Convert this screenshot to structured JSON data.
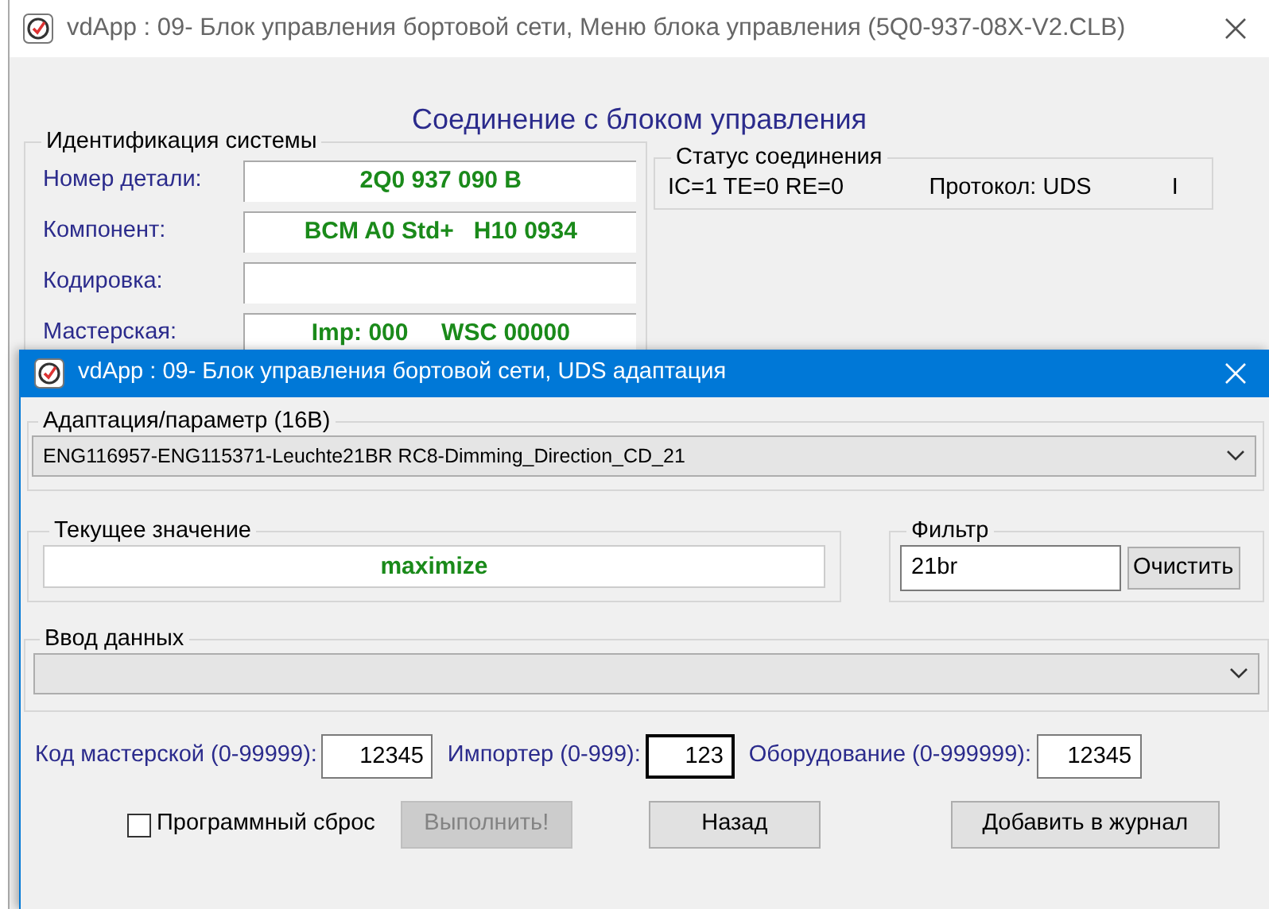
{
  "back_window": {
    "title": "vdApp : 09- Блок управления бортовой сети,  Меню блока управления (5Q0-937-08X-V2.CLB)",
    "heading": "Соединение с блоком управления",
    "identification": {
      "legend": "Идентификация системы",
      "rows": [
        {
          "label": "Номер детали:",
          "value": "2Q0 937 090 B"
        },
        {
          "label": "Компонент:",
          "value": "BCM A0 Std+   H10 0934"
        },
        {
          "label": "Кодировка:"
        },
        {
          "label": "Мастерская:",
          "value": "Imp: 000     WSC 00000"
        }
      ]
    },
    "status": {
      "legend": "Статус соединения",
      "items": [
        "IC=1 TE=0 RE=0",
        "Протокол: UDS",
        "I"
      ]
    }
  },
  "dialog": {
    "title": "vdApp : 09- Блок управления бортовой сети,  UDS адаптация",
    "adaptation": {
      "legend": "Адаптация/параметр (16B)",
      "value": "ENG116957-ENG115371-Leuchte21BR RC8-Dimming_Direction_CD_21"
    },
    "current": {
      "legend": "Текущее значение",
      "value": "maximize"
    },
    "filter": {
      "legend": "Фильтр",
      "value": "21br",
      "button": "Очистить"
    },
    "data_input": {
      "legend": "Ввод данных"
    },
    "codes": [
      {
        "label": "Код мастерской (0-99999):",
        "value": "12345"
      },
      {
        "label": "Импортер (0-999):",
        "value": "123"
      },
      {
        "label": "Оборудование (0-999999):",
        "value": "12345"
      }
    ],
    "reset": {
      "label": "Программный сброс",
      "checked": false
    },
    "buttons": [
      {
        "label": "Выполнить!",
        "disabled": true
      },
      {
        "label": "Назад",
        "disabled": false
      },
      {
        "label": "Добавить в журнал",
        "disabled": false
      }
    ]
  }
}
